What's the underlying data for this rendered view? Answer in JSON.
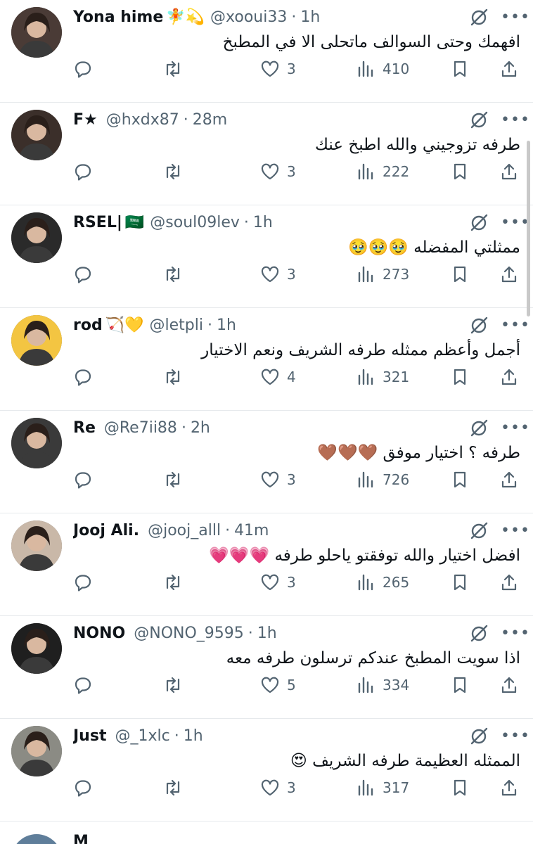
{
  "tweets": [
    {
      "name": "Yona hime",
      "name_emoji": "🧚💫",
      "handle": "@xooui33",
      "time": "1h",
      "text": "افهمك وحتى السوالف ماتحلى الا في المطبخ",
      "likes": "3",
      "views": "410",
      "avatar_color": "#4a3b36"
    },
    {
      "name": "F★",
      "name_emoji": "",
      "handle": "@hxdx87",
      "time": "28m",
      "text": "طرفه تزوجيني والله اطبخ عنك",
      "likes": "3",
      "views": "222",
      "avatar_color": "#3b2f2a"
    },
    {
      "name": "RSEL|",
      "name_emoji": "🇸🇦",
      "handle": "@soul09lev",
      "time": "1h",
      "text": "ممثلتي المفضله 🥹🥹🥹",
      "likes": "3",
      "views": "273",
      "avatar_color": "#2a2a2a"
    },
    {
      "name": "rod",
      "name_emoji": "🏹💛",
      "handle": "@letpli",
      "time": "1h",
      "text": "أجمل وأعظم ممثله طرفه الشريف ونعم الاختيار",
      "likes": "4",
      "views": "321",
      "avatar_color": "#f3c542"
    },
    {
      "name": "Re",
      "name_emoji": "",
      "handle": "@Re7ii88",
      "time": "2h",
      "text": "طرفه ؟ اختيار موفق 🤎🤎🤎",
      "likes": "3",
      "views": "726",
      "avatar_color": "#3a3a3a"
    },
    {
      "name": "Jooj Ali.",
      "name_emoji": "",
      "handle": "@jooj_alll",
      "time": "41m",
      "text": "افضل اختيار والله توفقتو ياحلو طرفه 💗💗💗",
      "likes": "3",
      "views": "265",
      "avatar_color": "#c9b8a8"
    },
    {
      "name": "NONO",
      "name_emoji": "",
      "handle": "@NONO_9595",
      "time": "1h",
      "text": "اذا سويت المطبخ عندكم ترسلون طرفه معه",
      "likes": "5",
      "views": "334",
      "avatar_color": "#1f1f1f"
    },
    {
      "name": "Just",
      "name_emoji": "",
      "handle": "@_1xlc",
      "time": "1h",
      "text": "الممثله العظيمة طرفه الشريف 😍",
      "likes": "3",
      "views": "317",
      "avatar_color": "#8b8b84"
    }
  ],
  "icons": {
    "reply": "reply-icon",
    "retweet": "retweet-icon",
    "like": "heart-icon",
    "views": "views-icon",
    "bookmark": "bookmark-icon",
    "share": "share-icon",
    "grok": "grok-icon",
    "more": "more-icon"
  },
  "colors": {
    "text": "#0f1419",
    "muted": "#536471",
    "divider": "#e6e9ec"
  },
  "cut_row": {
    "name": "M"
  }
}
